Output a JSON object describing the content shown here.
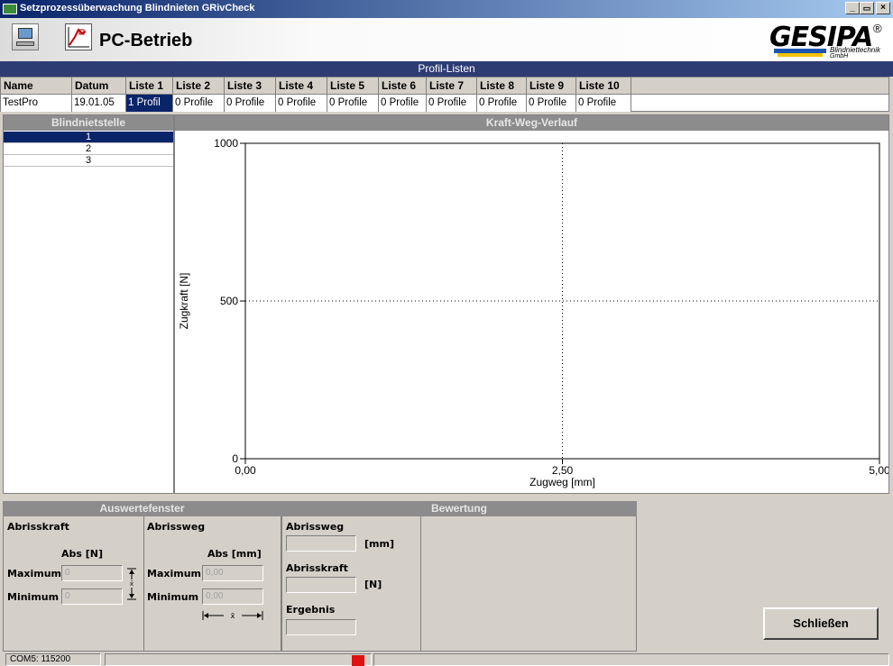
{
  "window": {
    "title": "Setzprozessüberwachung Blindnieten GRivCheck",
    "minimize": "_",
    "restore": "🗗",
    "close": "✕"
  },
  "header": {
    "mode_label": "PC-Betrieb",
    "logo_text": "GESIPA",
    "logo_reg": "®",
    "logo_sub1": "Blindniettechnik",
    "logo_sub2": "GmbH"
  },
  "profile_lists": {
    "title": "Profil-Listen",
    "columns": [
      "Name",
      "Datum",
      "Liste 1",
      "Liste 2",
      "Liste 3",
      "Liste 4",
      "Liste 5",
      "Liste 6",
      "Liste 7",
      "Liste 8",
      "Liste 9",
      "Liste 10"
    ],
    "row": [
      "TestPro",
      "19.01.05",
      "1 Profil",
      "0 Profile",
      "0 Profile",
      "0 Profile",
      "0 Profile",
      "0 Profile",
      "0 Profile",
      "0 Profile",
      "0 Profile",
      "0 Profile"
    ]
  },
  "rivet_points": {
    "title": "Blindnietstelle",
    "items": [
      "1",
      "2",
      "3"
    ],
    "selected_index": 0
  },
  "chart_data": {
    "type": "line",
    "title": "Kraft-Weg-Verlauf",
    "xlabel": "Zugweg [mm]",
    "ylabel": "Zugkraft [N]",
    "xlim": [
      0,
      5
    ],
    "ylim": [
      0,
      1000
    ],
    "x_ticks": [
      "0,00",
      "2,50",
      "5,00"
    ],
    "y_ticks": [
      "0",
      "500",
      "1000"
    ],
    "grid": "dotted center lines",
    "series": []
  },
  "evaluation_window": {
    "title": "Auswertefenster",
    "force": {
      "label": "Abrisskraft",
      "unit_label": "Abs [N]",
      "max_label": "Maximum",
      "min_label": "Minimum",
      "max_value": "0",
      "min_value": "0"
    },
    "travel": {
      "label": "Abrissweg",
      "unit_label": "Abs [mm]",
      "max_label": "Maximum",
      "min_label": "Minimum",
      "max_value": "0,00",
      "min_value": "0,00"
    }
  },
  "rating": {
    "title": "Bewertung",
    "travel_label": "Abrissweg",
    "travel_unit": "[mm]",
    "travel_value": "",
    "force_label": "Abrisskraft",
    "force_unit": "[N]",
    "force_value": "",
    "result_label": "Ergebnis",
    "result_value": ""
  },
  "close_button": "Schließen",
  "status": {
    "port": "COM5: 115200",
    "indicator_color": "#e01010"
  }
}
